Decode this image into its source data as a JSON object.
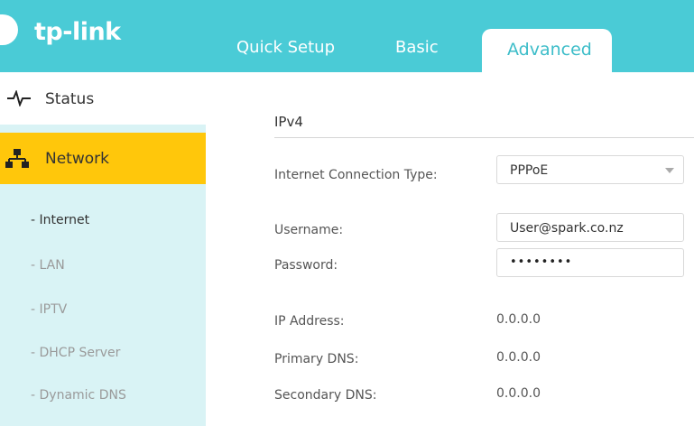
{
  "header": {
    "logo_text": "tp-link",
    "tabs": [
      {
        "label": "Quick Setup"
      },
      {
        "label": "Basic"
      },
      {
        "label": "Advanced"
      }
    ],
    "active_tab": "Advanced"
  },
  "sidebar": {
    "status_label": "Status",
    "network_label": "Network",
    "sub_items": [
      {
        "label": "- Internet"
      },
      {
        "label": "- LAN"
      },
      {
        "label": "- IPTV"
      },
      {
        "label": "- DHCP Server"
      },
      {
        "label": "- Dynamic DNS"
      }
    ]
  },
  "main": {
    "section_title": "IPv4",
    "connection_type": {
      "label": "Internet Connection Type:",
      "value": "PPPoE"
    },
    "username": {
      "label": "Username:",
      "value": "User@spark.co.nz"
    },
    "password": {
      "label": "Password:",
      "masked_value": "••••••••"
    },
    "ip_address": {
      "label": "IP Address:",
      "value": "0.0.0.0"
    },
    "primary_dns": {
      "label": "Primary DNS:",
      "value": "0.0.0.0"
    },
    "secondary_dns": {
      "label": "Secondary DNS:",
      "value": "0.0.0.0"
    }
  },
  "colors": {
    "header": "#4acbd6",
    "sidebar": "#d9f3f5",
    "active_item": "#ffc70b"
  }
}
